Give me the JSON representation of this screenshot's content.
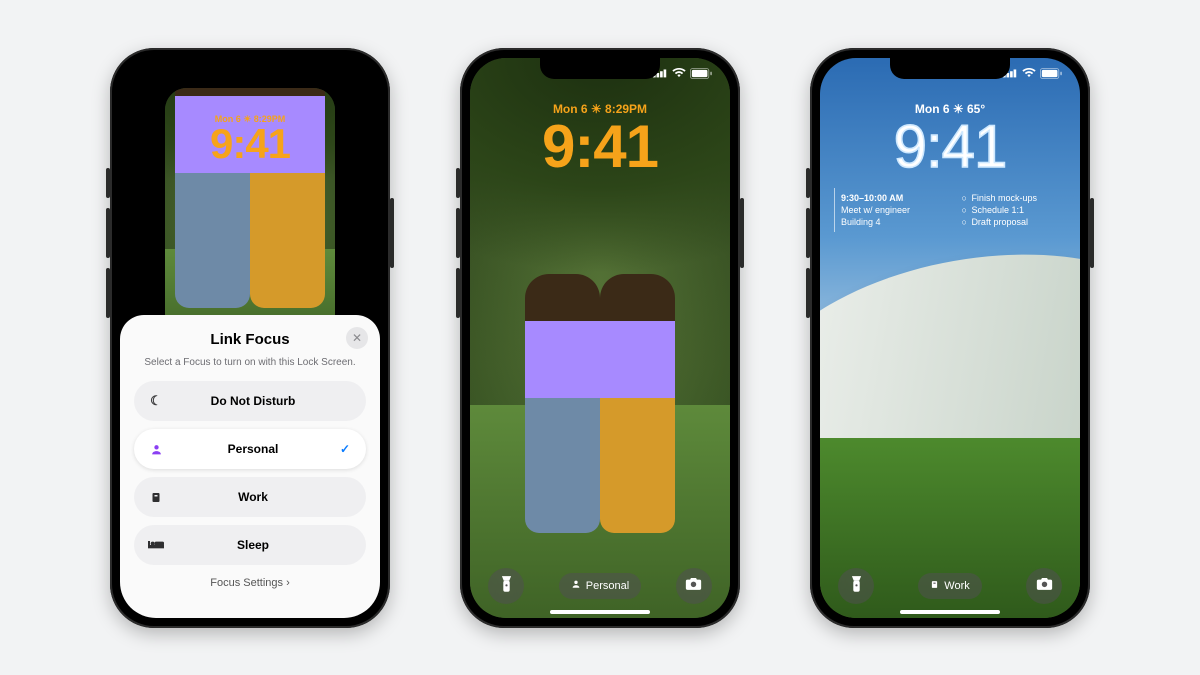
{
  "phone1": {
    "mini_lockscreen": {
      "date_line": "Mon 6  ☀︎  8:29PM",
      "time": "9:41"
    },
    "sheet": {
      "title": "Link Focus",
      "subtitle": "Select a Focus to turn on with this Lock Screen.",
      "options": {
        "dnd": {
          "label": "Do Not Disturb",
          "selected": false
        },
        "personal": {
          "label": "Personal",
          "selected": true
        },
        "work": {
          "label": "Work",
          "selected": false
        },
        "sleep": {
          "label": "Sleep",
          "selected": false
        }
      },
      "settings_link": "Focus Settings"
    }
  },
  "phone2": {
    "date_line": "Mon 6  ☀︎  8:29PM",
    "time": "9:41",
    "focus_pill": "Personal"
  },
  "phone3": {
    "date_line": "Mon 6  ☀︎  65°",
    "time": "9:41",
    "widget_calendar": {
      "time_range": "9:30–10:00 AM",
      "title": "Meet w/ engineer",
      "location": "Building 4"
    },
    "widget_reminders": {
      "item1": "Finish mock-ups",
      "item2": "Schedule 1:1",
      "item3": "Draft proposal"
    },
    "focus_pill": "Work"
  }
}
